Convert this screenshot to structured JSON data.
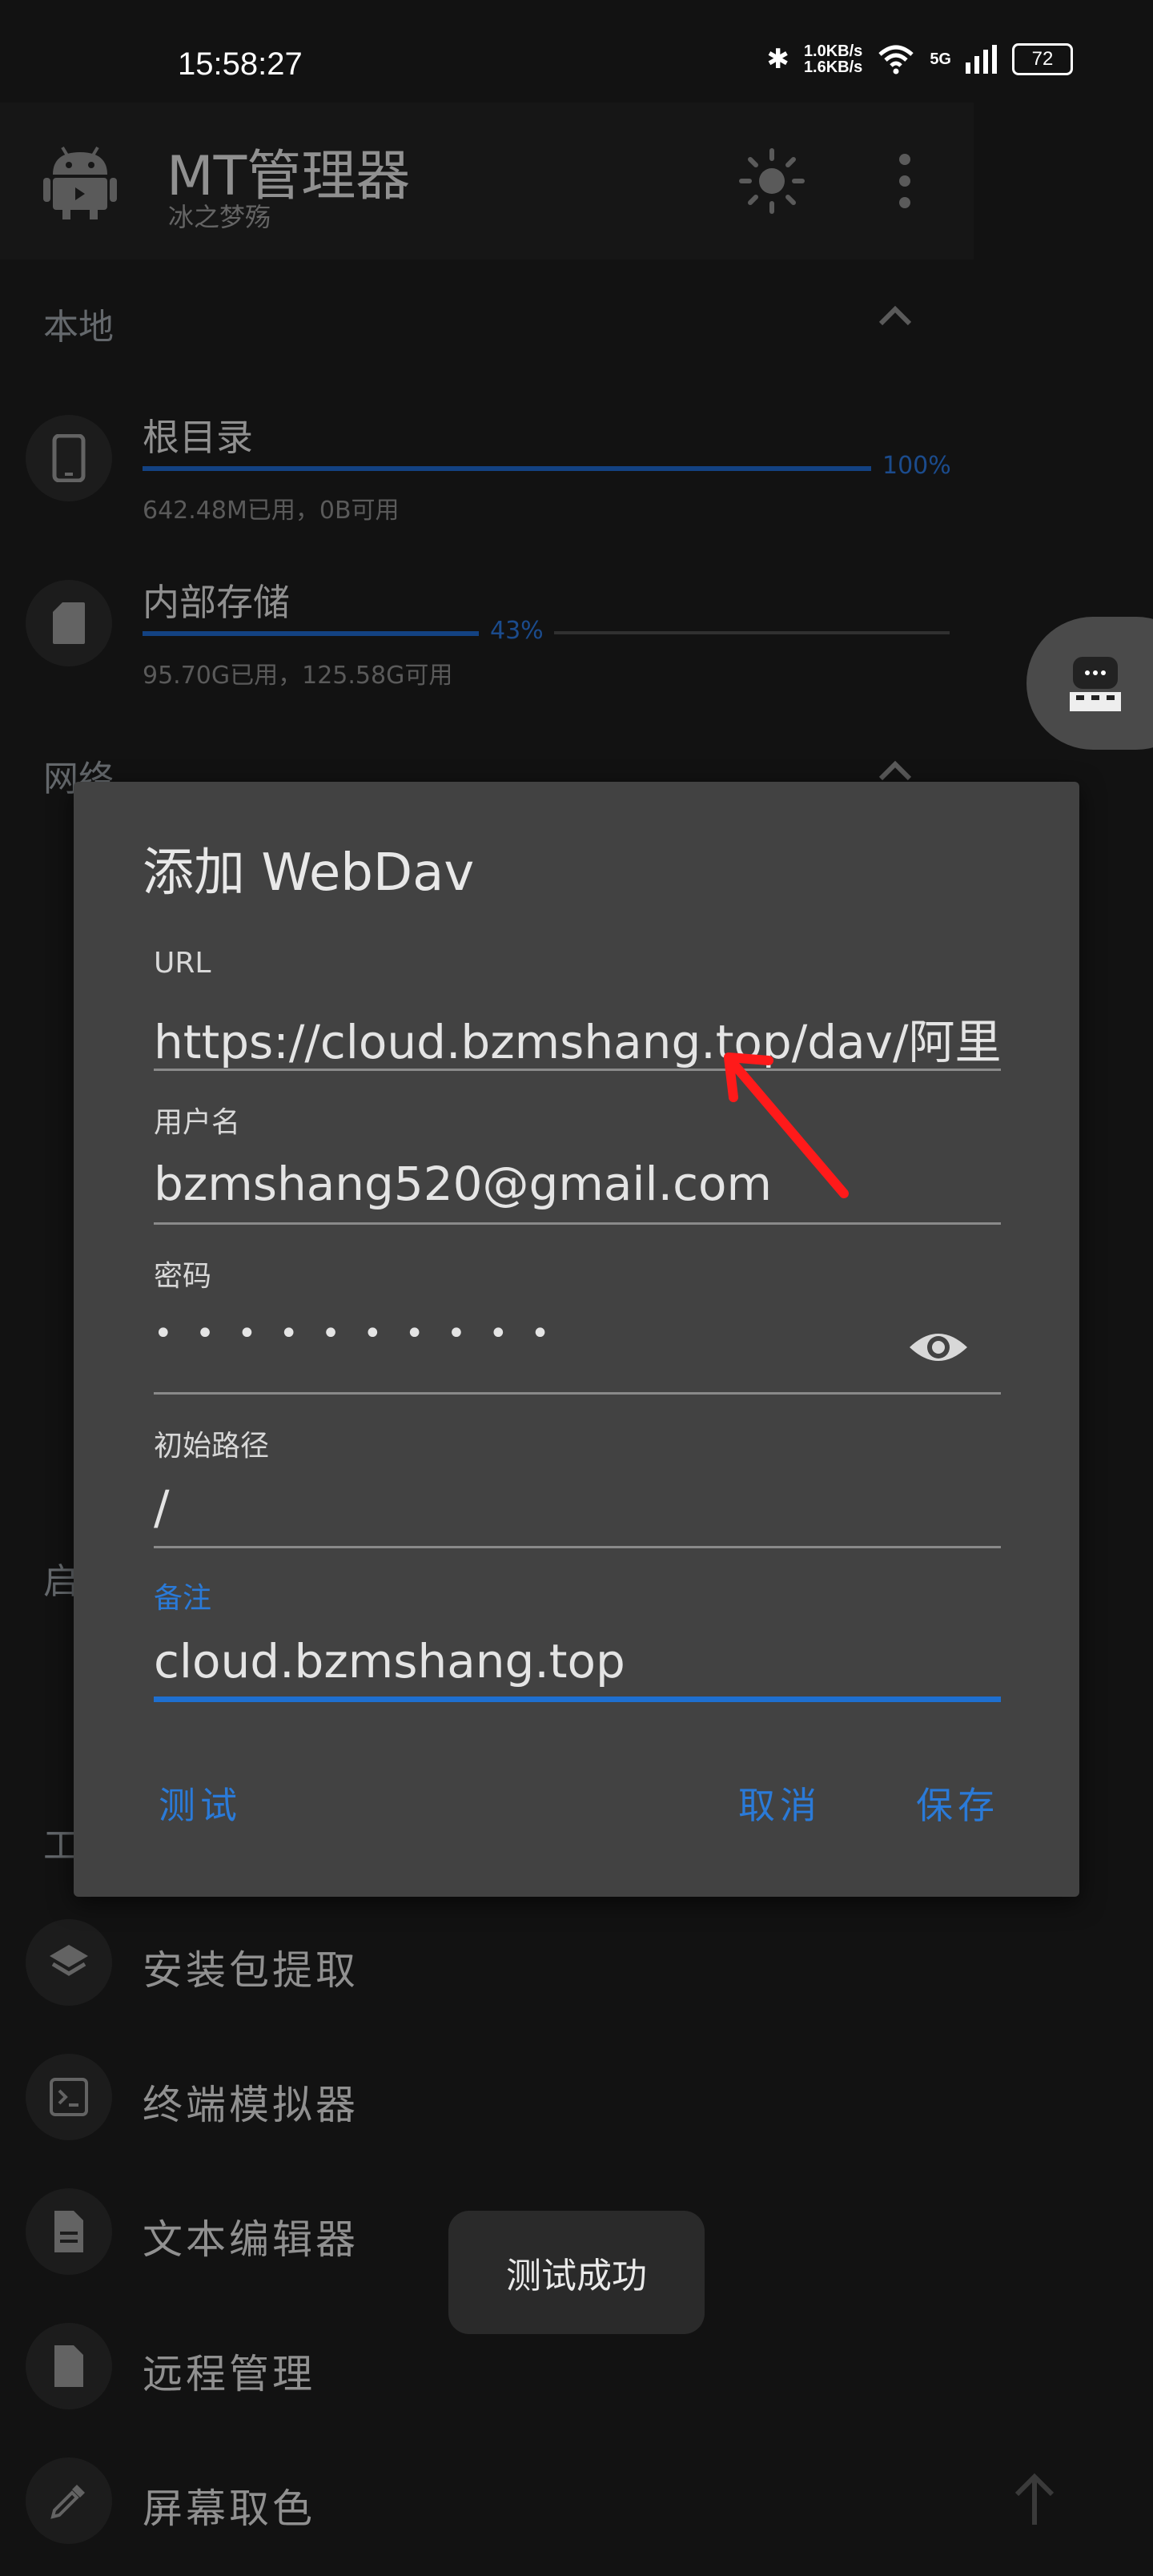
{
  "status_bar": {
    "time": "15:58:27",
    "net_speed_up": "1.0KB/s",
    "net_speed_down": "1.6KB/s",
    "network": "5G",
    "battery": "72"
  },
  "header": {
    "title": "MT管理器",
    "subtitle": "冰之梦殇"
  },
  "sections": {
    "local": "本地",
    "network": "网络",
    "startup": "启",
    "tools": "工"
  },
  "storage": [
    {
      "label": "根目录",
      "percent_label": "100%",
      "percent": 100,
      "detail": "642.48M已用，0B可用"
    },
    {
      "label": "内部存储",
      "percent_label": "43%",
      "percent": 43,
      "detail": "95.70G已用，125.58G可用"
    }
  ],
  "tools": [
    {
      "label": "安装包提取",
      "icon": "layers-icon"
    },
    {
      "label": "终端模拟器",
      "icon": "terminal-icon"
    },
    {
      "label": "文本编辑器",
      "icon": "document-icon"
    },
    {
      "label": "远程管理",
      "icon": "file-icon"
    },
    {
      "label": "屏幕取色",
      "icon": "eyedropper-icon"
    }
  ],
  "dialog": {
    "title": "添加 WebDav",
    "url_label": "URL",
    "url_value": "https://cloud.bzmshang.top/dav/阿里云",
    "username_label": "用户名",
    "username_value": "bzmshang520@gmail.com",
    "password_label": "密码",
    "password_value": "• • • • • • • • • •",
    "path_label": "初始路径",
    "path_value": "/",
    "note_label": "备注",
    "note_value": "cloud.bzmshang.top",
    "test_button": "测试",
    "cancel_button": "取消",
    "save_button": "保存"
  },
  "toast": "测试成功",
  "colors": {
    "accent": "#2a7ad8",
    "dialog_bg": "#424242",
    "annotation": "#ff1a1a"
  }
}
